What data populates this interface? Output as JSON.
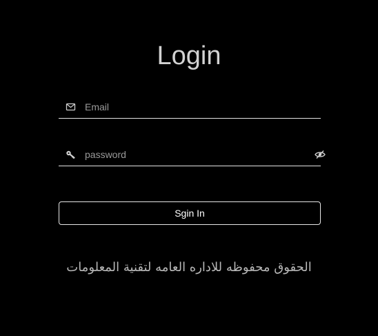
{
  "login": {
    "title": "Login",
    "email": {
      "placeholder": "Email",
      "value": "",
      "icon": "envelope-icon"
    },
    "password": {
      "placeholder": "password",
      "value": "",
      "icon": "key-icon",
      "toggle_icon": "eye-slash-icon"
    },
    "submit_label": "Sgin In",
    "footer_text": "الحقوق محفوظه للاداره العامه لتقنية المعلومات"
  },
  "colors": {
    "background": "#000000",
    "text": "#d4d4d4",
    "border": "#e4e4e4",
    "placeholder": "#9a9a9a"
  }
}
